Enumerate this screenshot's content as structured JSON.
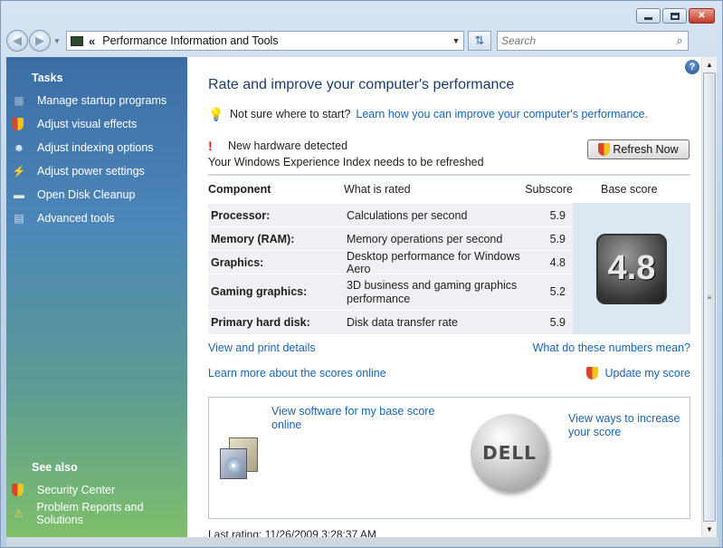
{
  "window": {
    "minimize_label": "_",
    "maximize_label": "□",
    "close_label": "✕"
  },
  "address": {
    "path_separator": "«",
    "location": "Performance Information and Tools",
    "search_placeholder": "Search"
  },
  "sidebar": {
    "tasks_heading": "Tasks",
    "tasks": [
      {
        "label": "Manage startup programs",
        "icon": "startup-grid-icon"
      },
      {
        "label": "Adjust visual effects",
        "icon": "shield-icon"
      },
      {
        "label": "Adjust indexing options",
        "icon": "indexing-icon"
      },
      {
        "label": "Adjust power settings",
        "icon": "power-icon"
      },
      {
        "label": "Open Disk Cleanup",
        "icon": "disk-icon"
      },
      {
        "label": "Advanced tools",
        "icon": "tools-icon"
      }
    ],
    "see_also_heading": "See also",
    "see_also": [
      {
        "label": "Security Center",
        "icon": "security-shield-icon"
      },
      {
        "label": "Problem Reports and Solutions",
        "icon": "problem-reports-icon"
      }
    ]
  },
  "main": {
    "title": "Rate and improve your computer's performance",
    "tip_text": "Not sure where to start?",
    "tip_link": "Learn how you can improve your computer's performance.",
    "alert_title": "New hardware detected",
    "alert_detail": "Your Windows Experience Index needs to be refreshed",
    "refresh_button": "Refresh Now",
    "table": {
      "headers": {
        "component": "Component",
        "what_is_rated": "What is rated",
        "subscore": "Subscore",
        "base_score": "Base score"
      },
      "rows": [
        {
          "component": "Processor:",
          "rated": "Calculations per second",
          "subscore": "5.9"
        },
        {
          "component": "Memory (RAM):",
          "rated": "Memory operations per second",
          "subscore": "5.9"
        },
        {
          "component": "Graphics:",
          "rated": "Desktop performance for Windows Aero",
          "subscore": "4.8"
        },
        {
          "component": "Gaming graphics:",
          "rated": "3D business and gaming graphics performance",
          "subscore": "5.2"
        },
        {
          "component": "Primary hard disk:",
          "rated": "Disk data transfer rate",
          "subscore": "5.9"
        }
      ],
      "base_score": "4.8"
    },
    "view_print_link": "View and print details",
    "what_numbers_link": "What do these numbers mean?",
    "learn_more_link": "Learn more about the scores online",
    "update_score_link": "Update my score",
    "promo": {
      "software_link": "View software for my base score online",
      "ways_link": "View ways to increase your score",
      "brand_logo_text": "DELL"
    },
    "last_rating": "Last rating: 11/26/2009 3:28:37 AM"
  },
  "colors": {
    "link": "#1565b5",
    "title": "#1b3c6b",
    "sidebar_top": "#3a6ea5",
    "sidebar_bottom": "#7fbf6a"
  }
}
